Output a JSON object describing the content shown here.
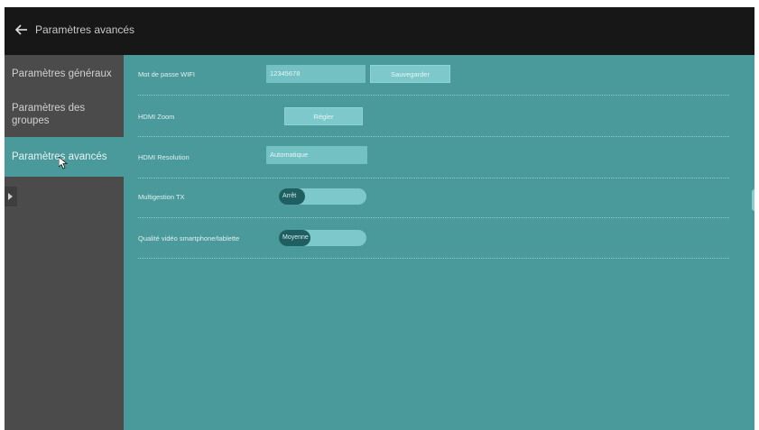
{
  "header": {
    "title": "Paramètres avancés"
  },
  "sidebar": {
    "items": [
      {
        "label": "Paramètres généraux"
      },
      {
        "label_line1": "Paramètres des",
        "label_line2": "groupes"
      },
      {
        "label": "Paramètres avancés",
        "active": true
      }
    ]
  },
  "settings": {
    "wifi": {
      "label": "Mot de passe WIFI",
      "value": "12345678",
      "button": "Sauvegarder"
    },
    "hdmi_zoom": {
      "label": "HDMI Zoom",
      "button": "Régler"
    },
    "hdmi_resolution": {
      "label": "HDMI Resolution",
      "value": "Automatique"
    },
    "multigestion": {
      "label": "Multigestion TX",
      "value": "Arrêt"
    },
    "video_quality": {
      "label": "Qualité vidéo smartphone/tablette",
      "value": "Moyenne"
    }
  },
  "colors": {
    "background": "#4a999b",
    "sidebar": "#4b4b4b",
    "header": "#171717",
    "active_item": "#4a999b"
  }
}
